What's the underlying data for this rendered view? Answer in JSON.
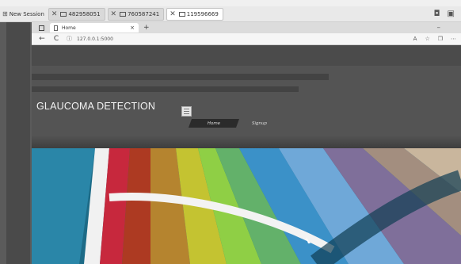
{
  "session_bar": {
    "label": "New Session",
    "tabs": [
      {
        "label": "482958051",
        "active": false
      },
      {
        "label": "760587241",
        "active": false
      },
      {
        "label": "119596669",
        "active": true
      }
    ]
  },
  "browser": {
    "tab_title": "Home",
    "close_glyph": "×",
    "new_tab_glyph": "+",
    "min_glyph": "–",
    "url": "127.0.0.1:5000",
    "nav_glyphs": {
      "back": "←",
      "forward": "→",
      "reload": "C"
    }
  },
  "site": {
    "title": "GLAUCOMA DETECTION",
    "nav": {
      "home": "Home",
      "signup": "Signup"
    }
  },
  "colors": {
    "site_background": "#545454",
    "nav_active_background": "#2b2b2b",
    "banner_primary": "#1f6f8c"
  },
  "icons": [
    "windows-icon",
    "close-icon",
    "monitor-icon",
    "pin-icon",
    "grid-icon",
    "page-icon",
    "info-icon",
    "read-aloud-icon",
    "favorites-icon",
    "collections-icon",
    "menu-icon"
  ],
  "banner_description": "color swatch fan"
}
